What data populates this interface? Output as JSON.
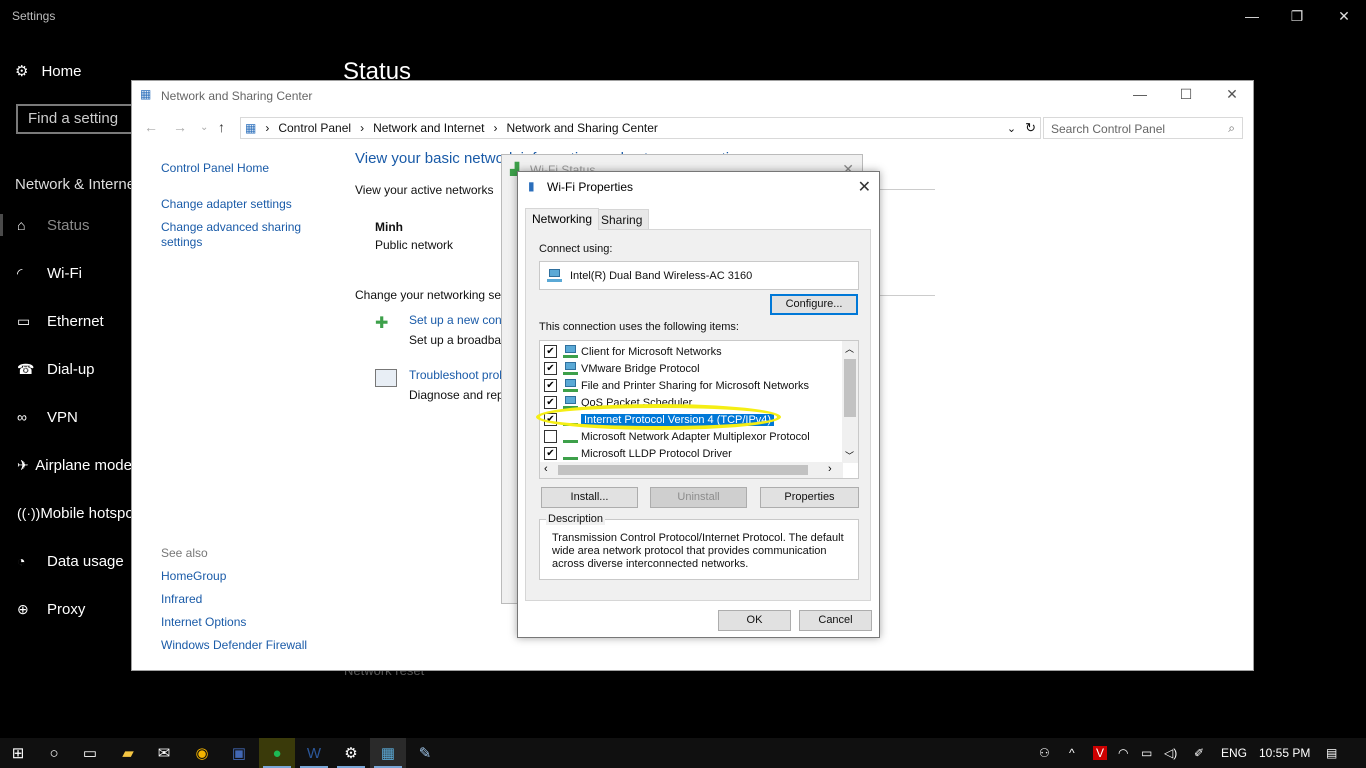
{
  "settings": {
    "title": "Settings",
    "home": "Home",
    "find_placeholder": "Find a setting",
    "group": "Network & Internet",
    "heading": "Status",
    "nav": [
      {
        "label": "Status",
        "icon": "home-status-icon"
      },
      {
        "label": "Wi-Fi",
        "icon": "wifi-icon"
      },
      {
        "label": "Ethernet",
        "icon": "ethernet-icon"
      },
      {
        "label": "Dial-up",
        "icon": "dialup-icon"
      },
      {
        "label": "VPN",
        "icon": "vpn-icon"
      },
      {
        "label": "Airplane mode",
        "icon": "airplane-icon"
      },
      {
        "label": "Mobile hotspot",
        "icon": "hotspot-icon"
      },
      {
        "label": "Data usage",
        "icon": "data-usage-icon"
      },
      {
        "label": "Proxy",
        "icon": "proxy-icon"
      }
    ],
    "network_reset": "Network reset"
  },
  "nsc": {
    "title": "Network and Sharing Center",
    "breadcrumb": [
      "Control Panel",
      "Network and Internet",
      "Network and Sharing Center"
    ],
    "search_placeholder": "Search Control Panel",
    "sidebar": {
      "home": "Control Panel Home",
      "links": [
        "Change adapter settings",
        "Change advanced sharing settings"
      ],
      "see_also": "See also",
      "see_also_links": [
        "HomeGroup",
        "Infrared",
        "Internet Options",
        "Windows Defender Firewall"
      ]
    },
    "main": {
      "heading": "View your basic network information and set up connections",
      "active_networks": "View your active networks",
      "network_name": "Minh",
      "network_type": "Public network",
      "change_settings": "Change your networking settings",
      "setup_link": "Set up a new connection or network",
      "setup_desc": "Set up a broadband, dial-up, or VPN connection",
      "trouble_link": "Troubleshoot problems",
      "trouble_desc": "Diagnose and repair network problems"
    }
  },
  "wifi_status": {
    "title": "Wi-Fi Status"
  },
  "wifi_props": {
    "title": "Wi-Fi Properties",
    "tabs": [
      "Networking",
      "Sharing"
    ],
    "connect_using": "Connect using:",
    "adapter": "Intel(R) Dual Band Wireless-AC 3160",
    "configure": "Configure...",
    "items_label": "This connection uses the following items:",
    "items": [
      {
        "label": "Client for Microsoft Networks",
        "checked": true
      },
      {
        "label": "VMware Bridge Protocol",
        "checked": true
      },
      {
        "label": "File and Printer Sharing for Microsoft Networks",
        "checked": true
      },
      {
        "label": "QoS Packet Scheduler",
        "checked": true
      },
      {
        "label": "Internet Protocol Version 4 (TCP/IPv4)",
        "checked": true,
        "selected": true
      },
      {
        "label": "Microsoft Network Adapter Multiplexor Protocol",
        "checked": false
      },
      {
        "label": "Microsoft LLDP Protocol Driver",
        "checked": true
      }
    ],
    "install": "Install...",
    "uninstall": "Uninstall",
    "properties": "Properties",
    "description_label": "Description",
    "description": "Transmission Control Protocol/Internet Protocol. The default wide area network protocol that provides communication across diverse interconnected networks.",
    "ok": "OK",
    "cancel": "Cancel"
  },
  "taskbar": {
    "time": "10:55 PM",
    "lang": "ENG"
  },
  "colors": {
    "accent": "#0078d7",
    "highlight_ring": "#f5ee14",
    "link": "#1a5ba8"
  }
}
